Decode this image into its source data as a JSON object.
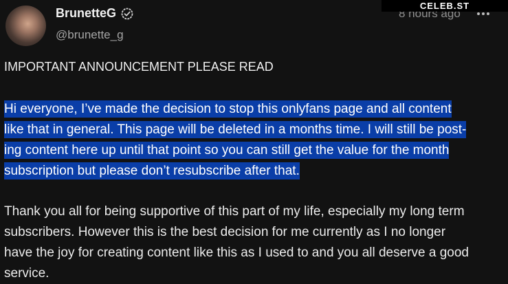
{
  "post": {
    "author": {
      "display_name": "BrunetteG",
      "handle": "@brunette_g",
      "verified": true
    },
    "timestamp": "8 hours ago",
    "more_icon": "more-horizontal-icon",
    "headline": "IMPORTANT ANNOUNCEMENT PLEASE READ",
    "paragraph1_lines": [
      "Hi everyone, I’ve made the decision to stop this onlyfans page and all content",
      "like that in general. This page will be deleted in a months time. I will still be post-",
      "ing content here up until that point so you can still get the value for the month",
      "subscription but please don’t resubscribe after that."
    ],
    "paragraph2_lines": [
      "Thank you all for being supportive of this part of my life, especially my long term",
      "subscribers. However this is the best decision for me currently as I no longer",
      "have the joy for creating content like this as I used to and you all deserve a good",
      "service."
    ]
  },
  "watermark": "CELEB.ST",
  "colors": {
    "background": "#121212",
    "selection": "#0a3ea8",
    "text": "#ececec"
  }
}
